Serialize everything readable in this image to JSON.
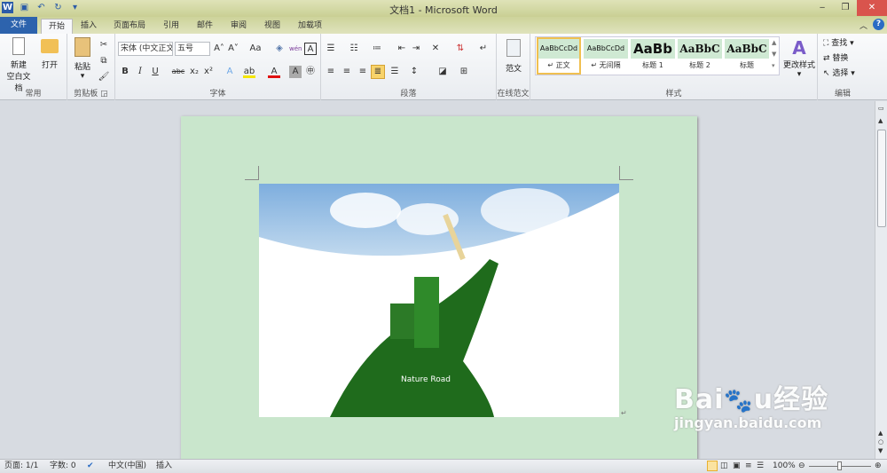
{
  "window": {
    "title": "文档1 - Microsoft Word",
    "minimize": "‒",
    "restore": "❐",
    "close": "✕"
  },
  "tabs": [
    {
      "label": "文件"
    },
    {
      "label": "开始"
    },
    {
      "label": "插入"
    },
    {
      "label": "页面布局"
    },
    {
      "label": "引用"
    },
    {
      "label": "邮件"
    },
    {
      "label": "审阅"
    },
    {
      "label": "视图"
    },
    {
      "label": "加载项"
    }
  ],
  "ribbon": {
    "common": {
      "label": "常用",
      "new_line1": "新建",
      "new_line2": "空白文档",
      "open": "打开"
    },
    "clipboard": {
      "label": "剪贴板",
      "paste": "粘贴"
    },
    "font": {
      "label": "字体",
      "font_name": "宋体 (中文正文)",
      "font_size": "五号",
      "bold": "B",
      "italic": "I",
      "underline": "U",
      "strike": "abc",
      "sub": "x₂",
      "sup": "x²",
      "grow": "A˄",
      "shrink": "A˅",
      "case": "Aa",
      "char_border": "A",
      "char_shading": "A",
      "enclose": "㊥",
      "phonetic": "wén",
      "text_effect": "A",
      "highlight": "ab",
      "font_color": "A"
    },
    "paragraph": {
      "label": "段落"
    },
    "template": {
      "label": "在线范文",
      "btn": "范文"
    },
    "styles": {
      "label": "样式",
      "items": [
        {
          "sample": "AaBbCcDd",
          "name": "↵ 正文"
        },
        {
          "sample": "AaBbCcDd",
          "name": "↵ 无间隔"
        },
        {
          "sample": "AaBb",
          "name": "标题 1"
        },
        {
          "sample": "AaBbC",
          "name": "标题 2"
        },
        {
          "sample": "AaBbC",
          "name": "标题"
        }
      ],
      "change": "更改样式"
    },
    "editing": {
      "label": "编辑",
      "find": "查找",
      "replace": "替换",
      "select": "选择"
    }
  },
  "document": {
    "image_title": "Nature Road"
  },
  "status": {
    "page": "页面: 1/1",
    "words": "字数: 0",
    "language": "中文(中国)",
    "mode": "插入",
    "zoom": "100%"
  },
  "watermark": {
    "brand": "Baidu经验",
    "url": "jingyan.baidu.com"
  }
}
